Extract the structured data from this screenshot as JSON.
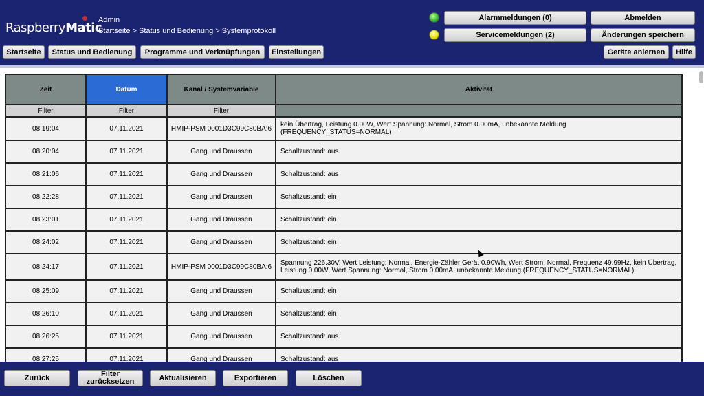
{
  "header": {
    "logo_plain": "Raspberry",
    "logo_bold": "Matic",
    "user": "Admin",
    "breadcrumb": "Startseite > Status und Bedienung > Systemprotokoll",
    "alarm_label": "Alarmmeldungen (0)",
    "service_label": "Servicemeldungen (2)",
    "logout_label": "Abmelden",
    "save_label": "Änderungen speichern",
    "nav": [
      "Startseite",
      "Status und Bedienung",
      "Programme und Verknüpfungen",
      "Einstellungen"
    ],
    "learn_label": "Geräte anlernen",
    "help_label": "Hilfe"
  },
  "table": {
    "headers": [
      "Zeit",
      "Datum",
      "Kanal / Systemvariable",
      "Aktivität"
    ],
    "filter_label": "Filter",
    "rows": [
      {
        "time": "08:19:04",
        "date": "07.11.2021",
        "channel": "HMIP-PSM 0001D3C99C80BA:6",
        "activity": "kein Übertrag, Leistung 0.00W, Wert Spannung: Normal, Strom 0.00mA, unbekannte Meldung (FREQUENCY_STATUS=NORMAL)"
      },
      {
        "time": "08:20:04",
        "date": "07.11.2021",
        "channel": "Gang und Draussen",
        "activity": "Schaltzustand: aus"
      },
      {
        "time": "08:21:06",
        "date": "07.11.2021",
        "channel": "Gang und Draussen",
        "activity": "Schaltzustand: aus"
      },
      {
        "time": "08:22:28",
        "date": "07.11.2021",
        "channel": "Gang und Draussen",
        "activity": "Schaltzustand: ein"
      },
      {
        "time": "08:23:01",
        "date": "07.11.2021",
        "channel": "Gang und Draussen",
        "activity": "Schaltzustand: ein"
      },
      {
        "time": "08:24:02",
        "date": "07.11.2021",
        "channel": "Gang und Draussen",
        "activity": "Schaltzustand: ein"
      },
      {
        "time": "08:24:17",
        "date": "07.11.2021",
        "channel": "HMIP-PSM 0001D3C99C80BA:6",
        "activity": "Spannung 226.30V, Wert Leistung: Normal, Energie-Zähler Gerät 0.90Wh, Wert Strom: Normal, Frequenz 49.99Hz, kein Übertrag, Leistung 0.00W, Wert Spannung: Normal, Strom 0.00mA, unbekannte Meldung (FREQUENCY_STATUS=NORMAL)"
      },
      {
        "time": "08:25:09",
        "date": "07.11.2021",
        "channel": "Gang und Draussen",
        "activity": "Schaltzustand: ein"
      },
      {
        "time": "08:26:10",
        "date": "07.11.2021",
        "channel": "Gang und Draussen",
        "activity": "Schaltzustand: ein"
      },
      {
        "time": "08:26:25",
        "date": "07.11.2021",
        "channel": "Gang und Draussen",
        "activity": "Schaltzustand: aus"
      },
      {
        "time": "08:27:25",
        "date": "07.11.2021",
        "channel": "Gang und Draussen",
        "activity": "Schaltzustand: aus"
      }
    ]
  },
  "footer": {
    "back_label": "Zurück",
    "reset_filter_label": "Filter zurücksetzen",
    "refresh_label": "Aktualisieren",
    "export_label": "Exportieren",
    "delete_label": "Löschen"
  },
  "colors": {
    "background": "#1a2470",
    "active_header": "#2a6bd6",
    "header_cell": "#7d8a87"
  }
}
